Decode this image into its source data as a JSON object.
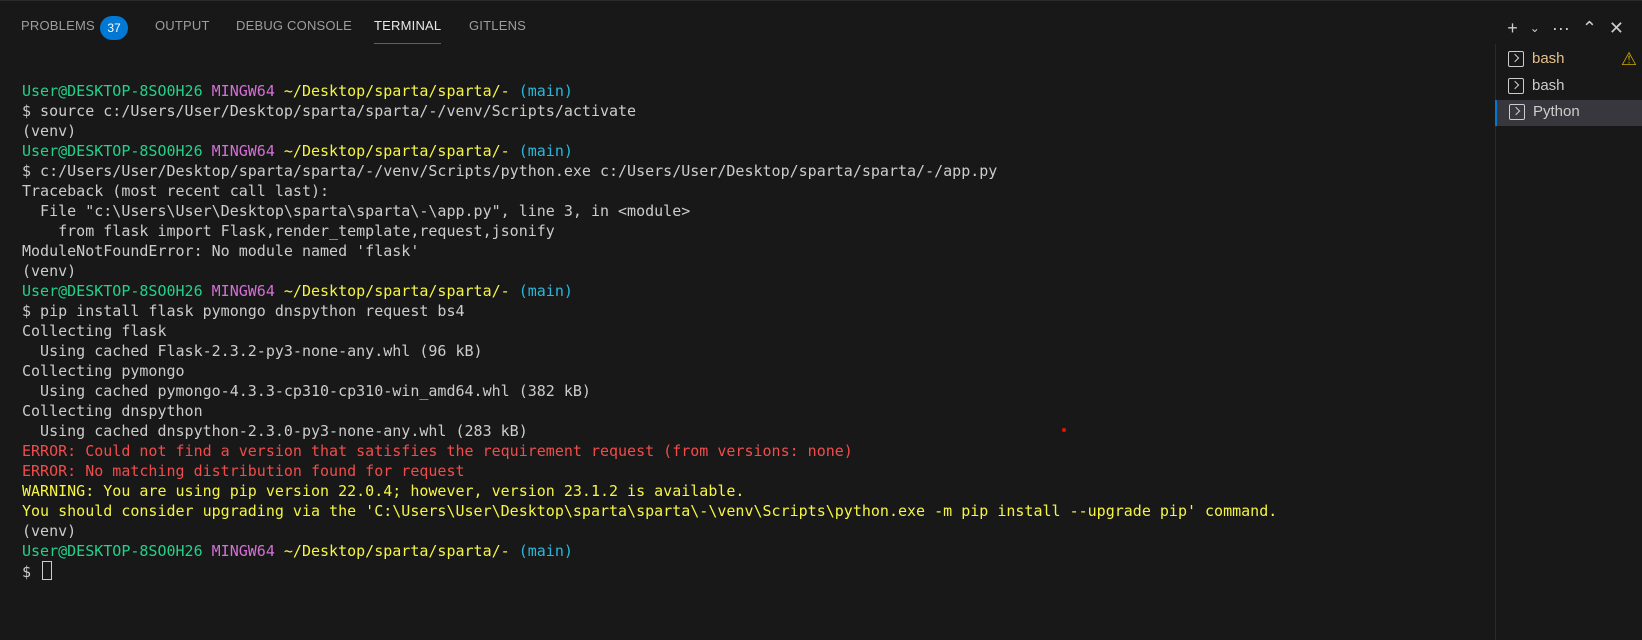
{
  "tabs": [
    {
      "label": "PROBLEMS"
    },
    {
      "label": "OUTPUT"
    },
    {
      "label": "DEBUG CONSOLE"
    },
    {
      "label": "TERMINAL"
    },
    {
      "label": "GITLENS"
    }
  ],
  "problems_count": "37",
  "actions": {
    "new_terminal": "+",
    "dropdown": "⌄",
    "more": "···",
    "maximize": "⌃",
    "close": "✕"
  },
  "prompt": {
    "user": "User@DESKTOP-8SO0H26",
    "system": "MINGW64",
    "path": "~/Desktop/sparta/sparta/-",
    "branch": "(main)"
  },
  "terminal_lines": [
    {
      "type": "plain",
      "text": "$ source c:/Users/User/Desktop/sparta/sparta/-/venv/Scripts/activate"
    },
    {
      "type": "plain",
      "text": "(venv)"
    },
    {
      "type": "plain",
      "text": "$ c:/Users/User/Desktop/sparta/sparta/-/venv/Scripts/python.exe c:/Users/User/Desktop/sparta/sparta/-/app.py"
    },
    {
      "type": "plain",
      "text": "Traceback (most recent call last):"
    },
    {
      "type": "plain",
      "text": "  File \"c:\\Users\\User\\Desktop\\sparta\\sparta\\-\\app.py\", line 3, in <module>"
    },
    {
      "type": "plain",
      "text": "    from flask import Flask,render_template,request,jsonify"
    },
    {
      "type": "plain",
      "text": "ModuleNotFoundError: No module named 'flask'"
    },
    {
      "type": "plain",
      "text": "(venv)"
    },
    {
      "type": "plain",
      "text": "$ pip install flask pymongo dnspython request bs4"
    },
    {
      "type": "plain",
      "text": "Collecting flask"
    },
    {
      "type": "plain",
      "text": "  Using cached Flask-2.3.2-py3-none-any.whl (96 kB)"
    },
    {
      "type": "plain",
      "text": "Collecting pymongo"
    },
    {
      "type": "plain",
      "text": "  Using cached pymongo-4.3.3-cp310-cp310-win_amd64.whl (382 kB)"
    },
    {
      "type": "plain",
      "text": "Collecting dnspython"
    },
    {
      "type": "plain",
      "text": "  Using cached dnspython-2.3.0-py3-none-any.whl (283 kB)"
    },
    {
      "type": "error",
      "text": "ERROR: Could not find a version that satisfies the requirement request (from versions: none)"
    },
    {
      "type": "error",
      "text": "ERROR: No matching distribution found for request"
    },
    {
      "type": "warning",
      "text": "WARNING: You are using pip version 22.0.4; however, version 23.1.2 is available."
    },
    {
      "type": "warning",
      "text": "You should consider upgrading via the 'C:\\Users\\User\\Desktop\\sparta\\sparta\\-\\venv\\Scripts\\python.exe -m pip install --upgrade pip' command."
    },
    {
      "type": "plain",
      "text": "(venv)"
    }
  ],
  "final_prompt": "$ ",
  "sidebar": {
    "items": [
      {
        "label": "bash"
      },
      {
        "label": "bash"
      },
      {
        "label": "Python"
      }
    ]
  },
  "colors": {
    "background": "#181818",
    "accent": "#0078d4",
    "prompt_user": "#23d18b",
    "prompt_system": "#d670d6",
    "prompt_path": "#f5f543",
    "prompt_branch": "#29b8db",
    "error": "#f14c4c",
    "warning": "#f5f543"
  }
}
